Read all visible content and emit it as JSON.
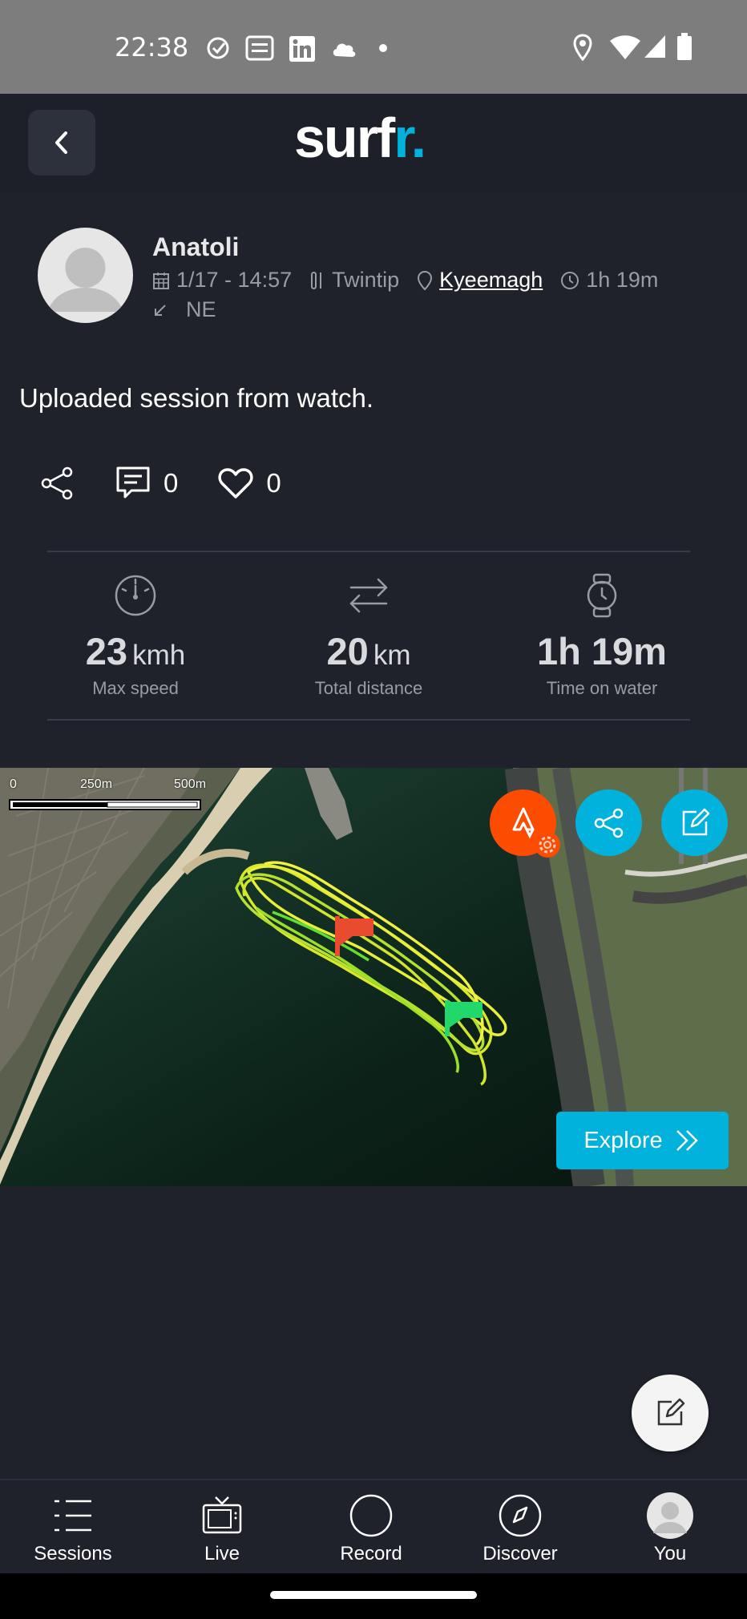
{
  "status_bar": {
    "time": "22:38",
    "left_icons": [
      "check-circle-icon",
      "optus-sport-icon",
      "linkedin-icon",
      "gear-cloud-icon",
      "dot-icon"
    ],
    "right_icons": [
      "location-icon",
      "wifi-icon",
      "signal-icon",
      "battery-icon"
    ]
  },
  "header": {
    "logo_main": "surf",
    "logo_accent": "r.",
    "back_icon": "chevron-left-icon"
  },
  "session": {
    "user_name": "Anatoli",
    "date": "1/17 - 14:57",
    "board": "Twintip",
    "location": "Kyeemagh",
    "duration": "1h 19m",
    "wind": "NE",
    "description": "Uploaded session from watch.",
    "comments_count": "0",
    "likes_count": "0"
  },
  "stats": [
    {
      "value": "23",
      "unit": "kmh",
      "label": "Max speed",
      "icon": "speedometer-icon"
    },
    {
      "value": "20",
      "unit": "km",
      "label": "Total distance",
      "icon": "arrows-exchange-icon"
    },
    {
      "value": "1h 19m",
      "unit": "",
      "label": "Time on water",
      "icon": "watch-icon"
    }
  ],
  "map": {
    "scale_labels": [
      "0",
      "250m",
      "500m"
    ],
    "explore_label": "Explore",
    "strava_color": "#fc4c02",
    "accent_color": "#00b2dc"
  },
  "bottom_nav": [
    {
      "label": "Sessions",
      "icon": "list-icon"
    },
    {
      "label": "Live",
      "icon": "tv-icon"
    },
    {
      "label": "Record",
      "icon": "record-circle-icon"
    },
    {
      "label": "Discover",
      "icon": "compass-icon"
    },
    {
      "label": "You",
      "icon": "avatar-icon"
    }
  ]
}
